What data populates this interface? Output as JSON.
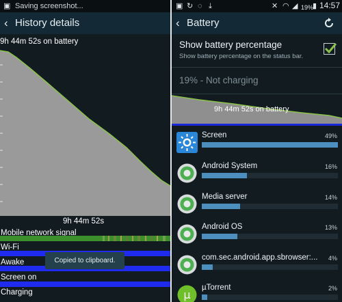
{
  "left": {
    "status_text": "Saving screenshot...",
    "title": "History details",
    "graph_label": "9h 44m 52s on battery",
    "duration": "9h 44m 52s",
    "rows": [
      {
        "label": "Mobile network signal",
        "bar": "signal"
      },
      {
        "label": "Wi-Fi",
        "bar": "blue"
      },
      {
        "label": "Awake",
        "bar": "blue"
      },
      {
        "label": "Screen on",
        "bar": "blue"
      },
      {
        "label": "Charging",
        "bar": "none"
      }
    ],
    "toast": "Copied to clipboard."
  },
  "right": {
    "status_battery": "19%",
    "status_time": "14:57",
    "title": "Battery",
    "setting_title": "Show battery percentage",
    "setting_subtitle": "Show battery percentage on the status bar.",
    "setting_checked": true,
    "charge_status": "19% - Not charging",
    "graph_label": "9h 44m 52s on battery",
    "apps": [
      {
        "name": "Screen",
        "percent_text": "49%",
        "fraction": 1.0,
        "icon": "brightness-icon"
      },
      {
        "name": "Android System",
        "percent_text": "16%",
        "fraction": 0.33,
        "icon": "android-system-icon"
      },
      {
        "name": "Media server",
        "percent_text": "14%",
        "fraction": 0.28,
        "icon": "media-server-icon"
      },
      {
        "name": "Android OS",
        "percent_text": "13%",
        "fraction": 0.26,
        "icon": "android-os-icon"
      },
      {
        "name": "com.sec.android.app.sbrowser:...",
        "percent_text": "4%",
        "fraction": 0.08,
        "icon": "app-process-icon"
      },
      {
        "name": "µTorrent",
        "percent_text": "2%",
        "fraction": 0.04,
        "icon": "utorrent-icon"
      }
    ]
  },
  "colors": {
    "accent_green": "#8bc34a",
    "graph_fill": "#9a9a9a",
    "usage_bar": "#4c8fbf",
    "state_bar_blue": "#1f2cf0",
    "signal_green": "#3c8f2a"
  }
}
